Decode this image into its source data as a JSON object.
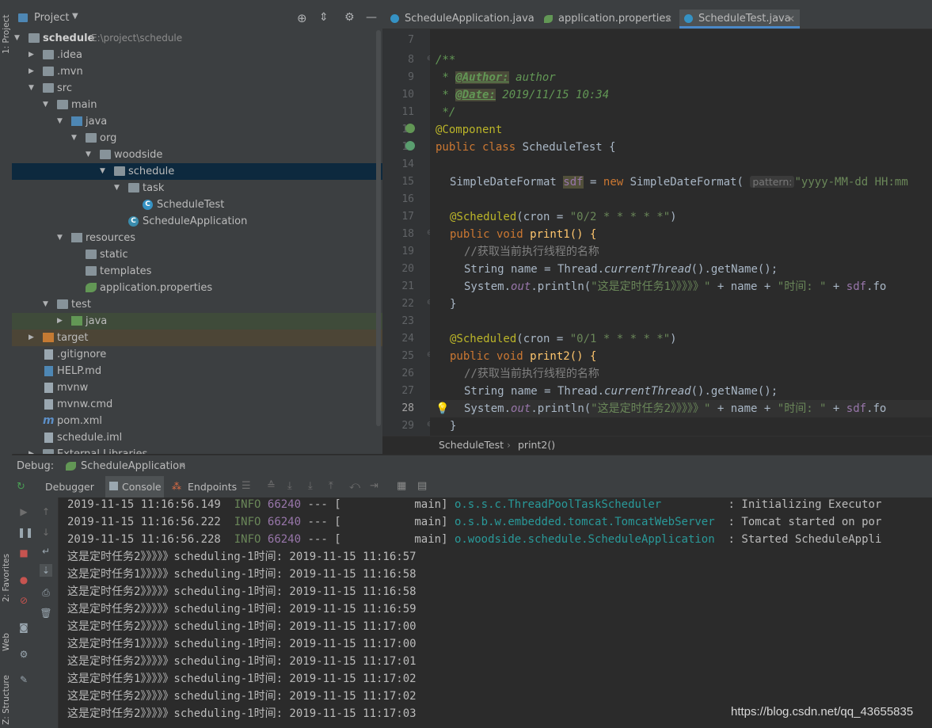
{
  "left_strip": {
    "project_tab": "1: Project",
    "favorites_tab": "2: Favorites",
    "web_tab": "Web",
    "structure_tab": "Z: Structure"
  },
  "project": {
    "title": "Project",
    "tree": [
      {
        "label": "schedule",
        "path": "E:\\project\\schedule"
      },
      {
        "label": ".idea"
      },
      {
        "label": ".mvn"
      },
      {
        "label": "src"
      },
      {
        "label": "main"
      },
      {
        "label": "java"
      },
      {
        "label": "org"
      },
      {
        "label": "woodside"
      },
      {
        "label": "schedule"
      },
      {
        "label": "task"
      },
      {
        "label": "ScheduleTest"
      },
      {
        "label": "ScheduleApplication"
      },
      {
        "label": "resources"
      },
      {
        "label": "static"
      },
      {
        "label": "templates"
      },
      {
        "label": "application.properties"
      },
      {
        "label": "test"
      },
      {
        "label": "java"
      },
      {
        "label": "target"
      },
      {
        "label": ".gitignore"
      },
      {
        "label": "HELP.md"
      },
      {
        "label": "mvnw"
      },
      {
        "label": "mvnw.cmd"
      },
      {
        "label": "pom.xml"
      },
      {
        "label": "schedule.iml"
      },
      {
        "label": "External Libraries"
      }
    ]
  },
  "editor": {
    "tabs": [
      {
        "label": "ScheduleApplication.java"
      },
      {
        "label": "application.properties"
      },
      {
        "label": "ScheduleTest.java"
      }
    ],
    "line_numbers": [
      "7",
      "8",
      "9",
      "10",
      "11",
      "12",
      "13",
      "14",
      "15",
      "16",
      "17",
      "18",
      "19",
      "20",
      "21",
      "22",
      "23",
      "24",
      "25",
      "26",
      "27",
      "28",
      "29"
    ],
    "code": {
      "l8": "/**",
      "l9_tag": "@Author:",
      "l9_val": " author",
      "l10_tag": "@Date:",
      "l10_val": " 2019/11/15 10:34",
      "l11": " */",
      "l12": "@Component",
      "l13_kw": "public class",
      "l13_rest": " ScheduleTest {",
      "l15_a": "SimpleDateFormat ",
      "l15_var": "sdf",
      "l15_b": " = ",
      "l15_new": "new",
      "l15_c": " SimpleDateFormat(",
      "l15_hint": "pattern:",
      "l15_str": "\"yyyy-MM-dd HH:mm",
      "l17_ann": "@Scheduled",
      "l17_a": "(cron = ",
      "l17_str": "\"0/2 * * * * *\"",
      "l17_b": ")",
      "l18_kw": "public void",
      "l18_rest": " print1() {",
      "l19": "//获取当前执行线程的名称",
      "l20_a": "String name = Thread.",
      "l20_it": "currentThread",
      "l20_b": "().getName();",
      "l21_a": "System.",
      "l21_out": "out",
      "l21_b": ".println(",
      "l21_str": "\"这是定时任务1》》》》》\"",
      "l21_c": " + name + ",
      "l21_str2": "\"时间: \"",
      "l21_d": " + ",
      "l21_sdf": "sdf",
      "l21_e": ".fo",
      "l22": "}",
      "l24_ann": "@Scheduled",
      "l24_a": "(cron = ",
      "l24_str": "\"0/1 * * * * *\"",
      "l24_b": ")",
      "l25_kw": "public void",
      "l25_rest": " print2() {",
      "l26": "//获取当前执行线程的名称",
      "l27_a": "String name = Thread.",
      "l27_it": "currentThread",
      "l27_b": "().getName();",
      "l28_a": "System.",
      "l28_out": "out",
      "l28_b": ".println(",
      "l28_str": "\"这是定时任务2》》》》》\"",
      "l28_c": " + name + ",
      "l28_str2": "\"时间: \"",
      "l28_d": " + ",
      "l28_sdf": "sdf",
      "l28_e": ".fo",
      "l29": "}"
    },
    "breadcrumb": {
      "class": "ScheduleTest",
      "method": "print2()"
    }
  },
  "debug": {
    "label": "Debug:",
    "config": "ScheduleApplication",
    "tabs": [
      {
        "label": "Debugger"
      },
      {
        "label": "Console"
      },
      {
        "label": "Endpoints"
      }
    ],
    "log": [
      {
        "ts": "2019-11-15 11:16:56.149",
        "level": "INFO",
        "pid": "66240",
        "sep": "--- [",
        "thread": "           main]",
        "logger": "o.s.s.c.ThreadPoolTaskScheduler",
        "msg": ": Initializing Executor"
      },
      {
        "ts": "2019-11-15 11:16:56.222",
        "level": "INFO",
        "pid": "66240",
        "sep": "--- [",
        "thread": "           main]",
        "logger": "o.s.b.w.embedded.tomcat.TomcatWebServer",
        "msg": ": Tomcat started on por"
      },
      {
        "ts": "2019-11-15 11:16:56.228",
        "level": "INFO",
        "pid": "66240",
        "sep": "--- [",
        "thread": "           main]",
        "logger": "o.woodside.schedule.ScheduleApplication",
        "msg": ": Started ScheduleAppli"
      }
    ],
    "output": [
      "这是定时任务2》》》》》scheduling-1时间: 2019-11-15 11:16:57",
      "这是定时任务1》》》》》scheduling-1时间: 2019-11-15 11:16:58",
      "这是定时任务2》》》》》scheduling-1时间: 2019-11-15 11:16:58",
      "这是定时任务2》》》》》scheduling-1时间: 2019-11-15 11:16:59",
      "这是定时任务2》》》》》scheduling-1时间: 2019-11-15 11:17:00",
      "这是定时任务1》》》》》scheduling-1时间: 2019-11-15 11:17:00",
      "这是定时任务2》》》》》scheduling-1时间: 2019-11-15 11:17:01",
      "这是定时任务1》》》》》scheduling-1时间: 2019-11-15 11:17:02",
      "这是定时任务2》》》》》scheduling-1时间: 2019-11-15 11:17:02",
      "这是定时任务2》》》》》scheduling-1时间: 2019-11-15 11:17:03"
    ]
  },
  "watermark": "https://blog.csdn.net/qq_43655835"
}
